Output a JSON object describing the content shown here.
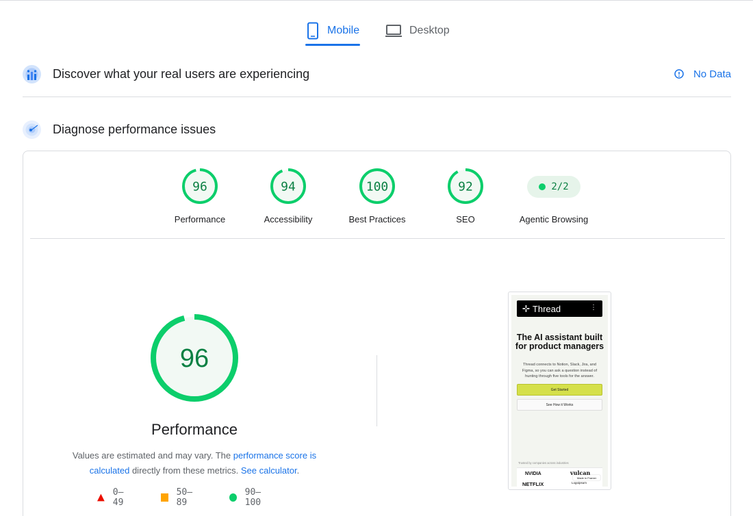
{
  "tabs": [
    {
      "label": "Mobile",
      "icon": "smartphone-icon",
      "active": true
    },
    {
      "label": "Desktop",
      "icon": "laptop-icon",
      "active": false
    }
  ],
  "real_users": {
    "title": "Discover what your real users are experiencing",
    "status": "No Data",
    "icon": "users-chart-icon"
  },
  "diagnose": {
    "title": "Diagnose performance issues",
    "icon": "radar-icon"
  },
  "scores": [
    {
      "label": "Performance",
      "score": 96
    },
    {
      "label": "Accessibility",
      "score": 94
    },
    {
      "label": "Best Practices",
      "score": 100
    },
    {
      "label": "SEO",
      "score": 92
    }
  ],
  "agentic": {
    "label": "Agentic Browsing",
    "value": "2/2"
  },
  "main": {
    "score": 96,
    "title": "Performance",
    "desc_before": "Values are estimated and may vary. The ",
    "desc_link1": "performance score is calculated",
    "desc_middle": " directly from these metrics. ",
    "desc_link2": "See calculator",
    "desc_after": "."
  },
  "legend": [
    {
      "range": "0–49",
      "shape": "triangle",
      "color": "#eb0f00"
    },
    {
      "range": "50–89",
      "shape": "square",
      "color": "#ffa400"
    },
    {
      "range": "90–100",
      "shape": "circle",
      "color": "#0cce6b"
    }
  ],
  "preview": {
    "brand": "Thread",
    "headline": "The AI assistant built for product managers",
    "body": "Thread connects to Notion, Slack, Jira, and Figma, so you can ask a question instead of hunting through five tools for the answer.",
    "primary_button": "Get Started",
    "secondary_button": "See How it Works",
    "trusted": "Trusted by companies across industries",
    "logos": [
      "NVIDIA",
      "NETFLIX",
      "vulcan",
      "Logoipsum"
    ],
    "badge": "Made in Framer"
  },
  "colors": {
    "accent": "#1a73e8",
    "pass": "#0cce6b",
    "pass_text": "#0b8043",
    "pass_bg": "#e6f4ea"
  }
}
